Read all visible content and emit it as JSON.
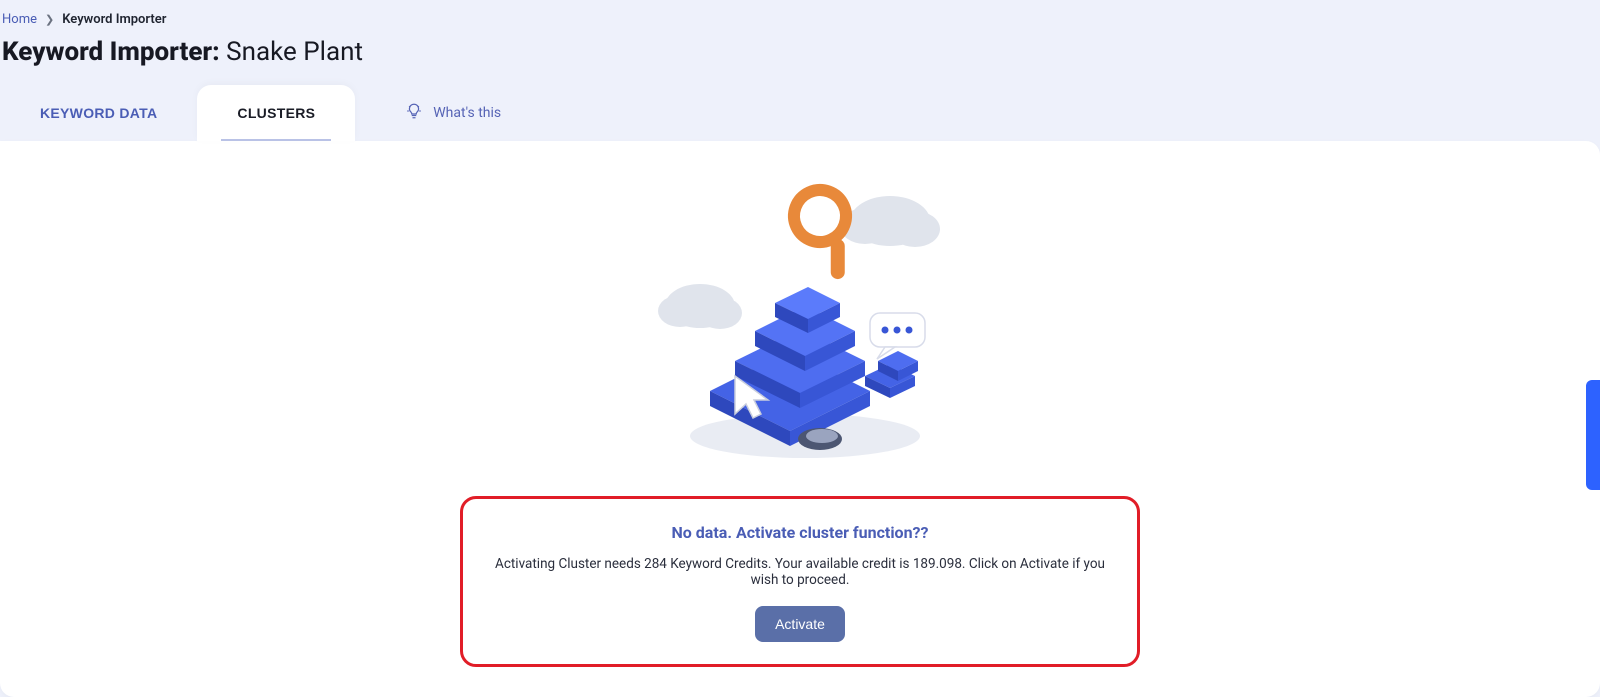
{
  "breadcrumb": {
    "home": "Home",
    "current": "Keyword Importer"
  },
  "title": {
    "prefix": "Keyword Importer: ",
    "subject": "Snake Plant"
  },
  "tabs": [
    {
      "label": "KEYWORD DATA",
      "active": false
    },
    {
      "label": "CLUSTERS",
      "active": true
    }
  ],
  "whats_this": "What's this",
  "callout": {
    "title": "No data. Activate cluster function??",
    "message": "Activating Cluster needs 284 Keyword Credits. Your available credit is 189.098. Click on Activate if you wish to proceed.",
    "button": "Activate"
  }
}
